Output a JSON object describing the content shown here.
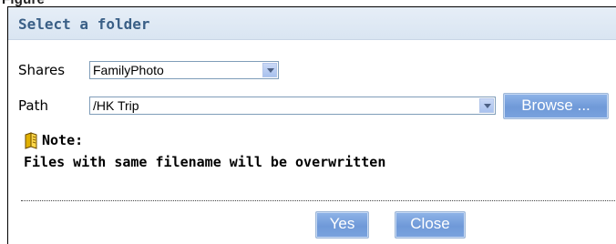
{
  "figure_caption_fragment": "Figure",
  "dialog": {
    "title": "Select a folder",
    "shares": {
      "label": "Shares",
      "value": "FamilyPhoto"
    },
    "path": {
      "label": "Path",
      "value": "/HK Trip"
    },
    "browse_label": "Browse ...",
    "note": {
      "icon": "note-icon",
      "title": "Note:",
      "text": "Files with same filename will be overwritten"
    },
    "yes_label": "Yes",
    "close_label": "Close"
  },
  "colors": {
    "title_text": "#3a5f86",
    "title_bar": "#dfe8f4",
    "button": "#7aa3de"
  }
}
